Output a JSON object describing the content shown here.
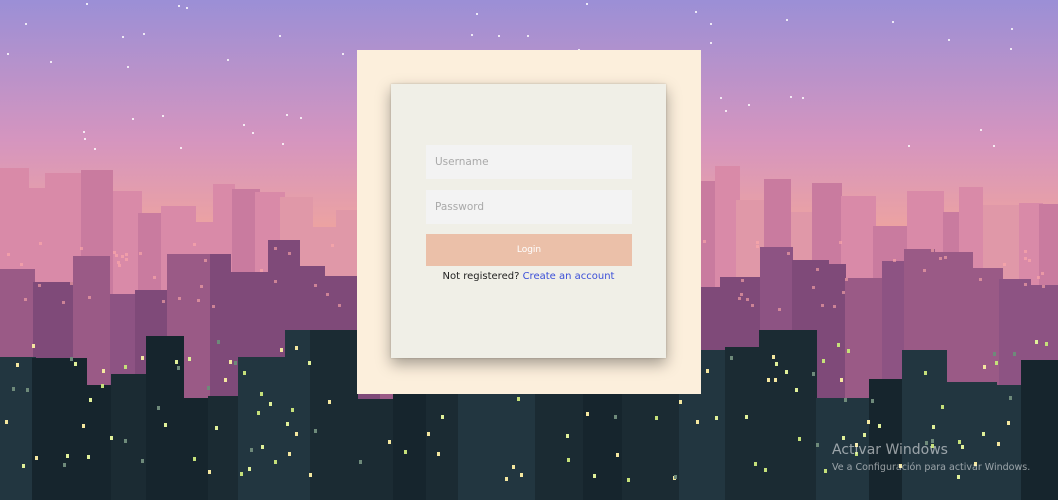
{
  "login": {
    "username_placeholder": "Username",
    "password_placeholder": "Password",
    "login_label": "Login",
    "register_prompt": "Not registered?",
    "register_link": "Create an account"
  },
  "watermark": {
    "title": "Activar Windows",
    "subtitle": "Ve a Configuración para activar Windows."
  },
  "colors": {
    "sky_top": "#9b8fd6",
    "sky_bottom": "#f7b48f",
    "panel": "#fcefdc",
    "card": "#f0efe7",
    "button": "#ebc0a9",
    "link": "#3b4fd8"
  }
}
